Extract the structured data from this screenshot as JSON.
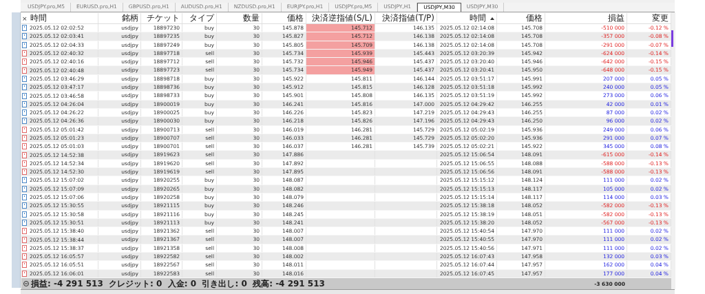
{
  "chart_tabs": [
    {
      "label": "USDJPY.pro,M5",
      "selected": false
    },
    {
      "label": "EURUSD.pro,H1",
      "selected": false
    },
    {
      "label": "GBPUSD.pro,H1",
      "selected": false
    },
    {
      "label": "AUDUSD.pro,H1",
      "selected": false
    },
    {
      "label": "NZDUSD.pro,H1",
      "selected": false
    },
    {
      "label": "EURJPY.pro,H1",
      "selected": false
    },
    {
      "label": "USDJPY.pro,M5",
      "selected": false
    },
    {
      "label": "USDJPY,H1",
      "selected": false
    },
    {
      "label": "USDJPY,M30",
      "selected": true
    },
    {
      "label": "USDJPY,M30",
      "selected": false
    }
  ],
  "table": {
    "close_glyph": "×",
    "columns": [
      {
        "label": "時間",
        "sorted": false
      },
      {
        "label": "銘柄",
        "sorted": false
      },
      {
        "label": "チケット",
        "sorted": false
      },
      {
        "label": "タイプ",
        "sorted": false
      },
      {
        "label": "数量",
        "sorted": false
      },
      {
        "label": "価格",
        "sorted": false
      },
      {
        "label": "決済逆指値(S/L)",
        "sorted": false
      },
      {
        "label": "決済指値(T/P)",
        "sorted": false
      },
      {
        "label": "時間",
        "sorted": true
      },
      {
        "label": "価格",
        "sorted": false
      },
      {
        "label": "損益",
        "sorted": false
      },
      {
        "label": "変更",
        "sorted": false
      }
    ],
    "rows": [
      {
        "kind": "buy",
        "open_time": "2025.05.12 02:02:52",
        "symbol": "usdjpy",
        "ticket": "18897230",
        "type": "buy",
        "volume": "30",
        "open_price": "145.878",
        "sl": "145.712",
        "sl_hit": true,
        "tp": "146.135",
        "close_time": "2025.05.12 02:14:08",
        "close_price": "145.708",
        "profit": "-510 000",
        "change": "-0.12 %",
        "loss": true
      },
      {
        "kind": "buy",
        "open_time": "2025.05.12 02:03:41",
        "symbol": "usdjpy",
        "ticket": "18897235",
        "type": "buy",
        "volume": "30",
        "open_price": "145.827",
        "sl": "145.712",
        "sl_hit": true,
        "tp": "146.138",
        "close_time": "2025.05.12 02:14:08",
        "close_price": "145.708",
        "profit": "-357 000",
        "change": "-0.08 %",
        "loss": true
      },
      {
        "kind": "buy",
        "open_time": "2025.05.12 02:04:33",
        "symbol": "usdjpy",
        "ticket": "18897249",
        "type": "buy",
        "volume": "30",
        "open_price": "145.805",
        "sl": "145.709",
        "sl_hit": true,
        "tp": "146.138",
        "close_time": "2025.05.12 02:14:08",
        "close_price": "145.708",
        "profit": "-291 000",
        "change": "-0.07 %",
        "loss": true
      },
      {
        "kind": "sell",
        "open_time": "2025.05.12 02:40:32",
        "symbol": "usdjpy",
        "ticket": "18897718",
        "type": "sell",
        "volume": "30",
        "open_price": "145.734",
        "sl": "145.939",
        "sl_hit": true,
        "tp": "145.443",
        "close_time": "2025.05.12 03:20:39",
        "close_price": "145.942",
        "profit": "-624 000",
        "change": "-0.14 %",
        "loss": true
      },
      {
        "kind": "sell",
        "open_time": "2025.05.12 02:40:16",
        "symbol": "usdjpy",
        "ticket": "18897712",
        "type": "sell",
        "volume": "30",
        "open_price": "145.732",
        "sl": "145.946",
        "sl_hit": true,
        "tp": "145.437",
        "close_time": "2025.05.12 03:20:40",
        "close_price": "145.946",
        "profit": "-642 000",
        "change": "-0.15 %",
        "loss": true
      },
      {
        "kind": "sell",
        "open_time": "2025.05.12 02:40:48",
        "symbol": "usdjpy",
        "ticket": "18897723",
        "type": "sell",
        "volume": "30",
        "open_price": "145.734",
        "sl": "145.949",
        "sl_hit": true,
        "tp": "145.437",
        "close_time": "2025.05.12 03:20:41",
        "close_price": "145.950",
        "profit": "-648 000",
        "change": "-0.15 %",
        "loss": true
      },
      {
        "kind": "buy",
        "open_time": "2025.05.12 03:46:29",
        "symbol": "usdjpy",
        "ticket": "18898718",
        "type": "buy",
        "volume": "30",
        "open_price": "145.922",
        "sl": "145.811",
        "sl_hit": false,
        "tp": "146.144",
        "close_time": "2025.05.12 03:51:17",
        "close_price": "145.991",
        "profit": "207 000",
        "change": "0.05 %",
        "loss": false
      },
      {
        "kind": "buy",
        "open_time": "2025.05.12 03:47:17",
        "symbol": "usdjpy",
        "ticket": "18898736",
        "type": "buy",
        "volume": "30",
        "open_price": "145.912",
        "sl": "145.815",
        "sl_hit": false,
        "tp": "146.128",
        "close_time": "2025.05.12 03:51:18",
        "close_price": "145.992",
        "profit": "240 000",
        "change": "0.05 %",
        "loss": false
      },
      {
        "kind": "buy",
        "open_time": "2025.05.12 03:46:58",
        "symbol": "usdjpy",
        "ticket": "18898733",
        "type": "buy",
        "volume": "30",
        "open_price": "145.901",
        "sl": "145.808",
        "sl_hit": false,
        "tp": "146.135",
        "close_time": "2025.05.12 03:51:19",
        "close_price": "145.992",
        "profit": "273 000",
        "change": "0.06 %",
        "loss": false
      },
      {
        "kind": "buy",
        "open_time": "2025.05.12 04:26:04",
        "symbol": "usdjpy",
        "ticket": "18900019",
        "type": "buy",
        "volume": "30",
        "open_price": "146.241",
        "sl": "145.816",
        "sl_hit": false,
        "tp": "147.000",
        "close_time": "2025.05.12 04:29:42",
        "close_price": "146.255",
        "profit": "42 000",
        "change": "0.01 %",
        "loss": false
      },
      {
        "kind": "buy",
        "open_time": "2025.05.12 04:26:22",
        "symbol": "usdjpy",
        "ticket": "18900025",
        "type": "buy",
        "volume": "30",
        "open_price": "146.226",
        "sl": "145.823",
        "sl_hit": false,
        "tp": "147.219",
        "close_time": "2025.05.12 04:29:43",
        "close_price": "146.255",
        "profit": "87 000",
        "change": "0.02 %",
        "loss": false
      },
      {
        "kind": "buy",
        "open_time": "2025.05.12 04:26:36",
        "symbol": "usdjpy",
        "ticket": "18900030",
        "type": "buy",
        "volume": "30",
        "open_price": "146.218",
        "sl": "145.826",
        "sl_hit": false,
        "tp": "147.196",
        "close_time": "2025.05.12 04:29:43",
        "close_price": "146.250",
        "profit": "96 000",
        "change": "0.02 %",
        "loss": false
      },
      {
        "kind": "sell",
        "open_time": "2025.05.12 05:01:42",
        "symbol": "usdjpy",
        "ticket": "18900713",
        "type": "sell",
        "volume": "30",
        "open_price": "146.019",
        "sl": "146.281",
        "sl_hit": false,
        "tp": "145.729",
        "close_time": "2025.05.12 05:02:19",
        "close_price": "145.936",
        "profit": "249 000",
        "change": "0.06 %",
        "loss": false
      },
      {
        "kind": "sell",
        "open_time": "2025.05.12 05:01:23",
        "symbol": "usdjpy",
        "ticket": "18900707",
        "type": "sell",
        "volume": "30",
        "open_price": "146.033",
        "sl": "146.281",
        "sl_hit": false,
        "tp": "145.729",
        "close_time": "2025.05.12 05:02:20",
        "close_price": "145.936",
        "profit": "291 000",
        "change": "0.07 %",
        "loss": false
      },
      {
        "kind": "sell",
        "open_time": "2025.05.12 05:01:03",
        "symbol": "usdjpy",
        "ticket": "18900701",
        "type": "sell",
        "volume": "30",
        "open_price": "146.037",
        "sl": "146.281",
        "sl_hit": false,
        "tp": "145.739",
        "close_time": "2025.05.12 05:02:21",
        "close_price": "145.922",
        "profit": "345 000",
        "change": "0.08 %",
        "loss": false
      },
      {
        "kind": "sell",
        "open_time": "2025.05.12 14:52:38",
        "symbol": "usdjpy",
        "ticket": "18919623",
        "type": "sell",
        "volume": "30",
        "open_price": "147.886",
        "sl_hit": false,
        "close_time": "2025.05.12 15:06:54",
        "close_price": "148.091",
        "profit": "-615 000",
        "change": "-0.14 %",
        "loss": true
      },
      {
        "kind": "sell",
        "open_time": "2025.05.12 14:52:34",
        "symbol": "usdjpy",
        "ticket": "18919620",
        "type": "sell",
        "volume": "30",
        "open_price": "147.892",
        "sl_hit": false,
        "close_time": "2025.05.12 15:06:55",
        "close_price": "148.088",
        "profit": "-588 000",
        "change": "-0.13 %",
        "loss": true
      },
      {
        "kind": "sell",
        "open_time": "2025.05.12 14:52:30",
        "symbol": "usdjpy",
        "ticket": "18919619",
        "type": "sell",
        "volume": "30",
        "open_price": "147.895",
        "sl_hit": false,
        "close_time": "2025.05.12 15:06:56",
        "close_price": "148.091",
        "profit": "-588 000",
        "change": "-0.13 %",
        "loss": true
      },
      {
        "kind": "buy",
        "open_time": "2025.05.12 15:07:02",
        "symbol": "usdjpy",
        "ticket": "18920255",
        "type": "buy",
        "volume": "30",
        "open_price": "148.087",
        "sl_hit": false,
        "close_time": "2025.05.12 15:15:12",
        "close_price": "148.124",
        "profit": "111 000",
        "change": "0.02 %",
        "loss": false
      },
      {
        "kind": "buy",
        "open_time": "2025.05.12 15:07:09",
        "symbol": "usdjpy",
        "ticket": "18920265",
        "type": "buy",
        "volume": "30",
        "open_price": "148.082",
        "sl_hit": false,
        "close_time": "2025.05.12 15:15:13",
        "close_price": "148.117",
        "profit": "105 000",
        "change": "0.02 %",
        "loss": false
      },
      {
        "kind": "buy",
        "open_time": "2025.05.12 15:07:06",
        "symbol": "usdjpy",
        "ticket": "18920258",
        "type": "buy",
        "volume": "30",
        "open_price": "148.079",
        "sl_hit": false,
        "close_time": "2025.05.12 15:15:14",
        "close_price": "148.117",
        "profit": "114 000",
        "change": "0.03 %",
        "loss": false
      },
      {
        "kind": "buy",
        "open_time": "2025.05.12 15:30:55",
        "symbol": "usdjpy",
        "ticket": "18921115",
        "type": "buy",
        "volume": "30",
        "open_price": "148.246",
        "sl_hit": false,
        "close_time": "2025.05.12 15:38:18",
        "close_price": "148.052",
        "profit": "-582 000",
        "change": "-0.13 %",
        "loss": true
      },
      {
        "kind": "buy",
        "open_time": "2025.05.12 15:30:58",
        "symbol": "usdjpy",
        "ticket": "18921116",
        "type": "buy",
        "volume": "30",
        "open_price": "148.245",
        "sl_hit": false,
        "close_time": "2025.05.12 15:38:19",
        "close_price": "148.051",
        "profit": "-582 000",
        "change": "-0.13 %",
        "loss": true
      },
      {
        "kind": "buy",
        "open_time": "2025.05.12 15:30:51",
        "symbol": "usdjpy",
        "ticket": "18921113",
        "type": "buy",
        "volume": "30",
        "open_price": "148.241",
        "sl_hit": false,
        "close_time": "2025.05.12 15:38:20",
        "close_price": "148.052",
        "profit": "-567 000",
        "change": "-0.13 %",
        "loss": true
      },
      {
        "kind": "sell",
        "open_time": "2025.05.12 15:38:40",
        "symbol": "usdjpy",
        "ticket": "18921362",
        "type": "sell",
        "volume": "30",
        "open_price": "148.007",
        "sl_hit": false,
        "close_time": "2025.05.12 15:40:54",
        "close_price": "147.970",
        "profit": "111 000",
        "change": "0.02 %",
        "loss": false
      },
      {
        "kind": "sell",
        "open_time": "2025.05.12 15:38:44",
        "symbol": "usdjpy",
        "ticket": "18921367",
        "type": "sell",
        "volume": "30",
        "open_price": "148.007",
        "sl_hit": false,
        "close_time": "2025.05.12 15:40:55",
        "close_price": "147.970",
        "profit": "111 000",
        "change": "0.02 %",
        "loss": false
      },
      {
        "kind": "sell",
        "open_time": "2025.05.12 15:38:37",
        "symbol": "usdjpy",
        "ticket": "18921358",
        "type": "sell",
        "volume": "30",
        "open_price": "148.008",
        "sl_hit": false,
        "close_time": "2025.05.12 15:40:56",
        "close_price": "147.971",
        "profit": "111 000",
        "change": "0.02 %",
        "loss": false
      },
      {
        "kind": "sell",
        "open_time": "2025.05.12 16:05:57",
        "symbol": "usdjpy",
        "ticket": "18922582",
        "type": "sell",
        "volume": "30",
        "open_price": "148.002",
        "sl_hit": false,
        "close_time": "2025.05.12 16:07:43",
        "close_price": "147.958",
        "profit": "132 000",
        "change": "0.03 %",
        "loss": false
      },
      {
        "kind": "sell",
        "open_time": "2025.05.12 16:05:51",
        "symbol": "usdjpy",
        "ticket": "18922567",
        "type": "sell",
        "volume": "30",
        "open_price": "148.011",
        "sl_hit": false,
        "close_time": "2025.05.12 16:07:44",
        "close_price": "147.957",
        "profit": "162 000",
        "change": "0.04 %",
        "loss": false
      },
      {
        "kind": "sell",
        "open_time": "2025.05.12 16:06:01",
        "symbol": "usdjpy",
        "ticket": "18922583",
        "type": "sell",
        "volume": "30",
        "open_price": "148.016",
        "sl_hit": false,
        "close_time": "2025.05.12 16:07:45",
        "close_price": "147.957",
        "profit": "177 000",
        "change": "0.04 %",
        "loss": false
      }
    ],
    "summary": {
      "text": "損益: -4 291 513  クレジット: 0  入金: 0  引き出し: 0  残高: -4 291 513",
      "total": "-3 630 000"
    }
  }
}
